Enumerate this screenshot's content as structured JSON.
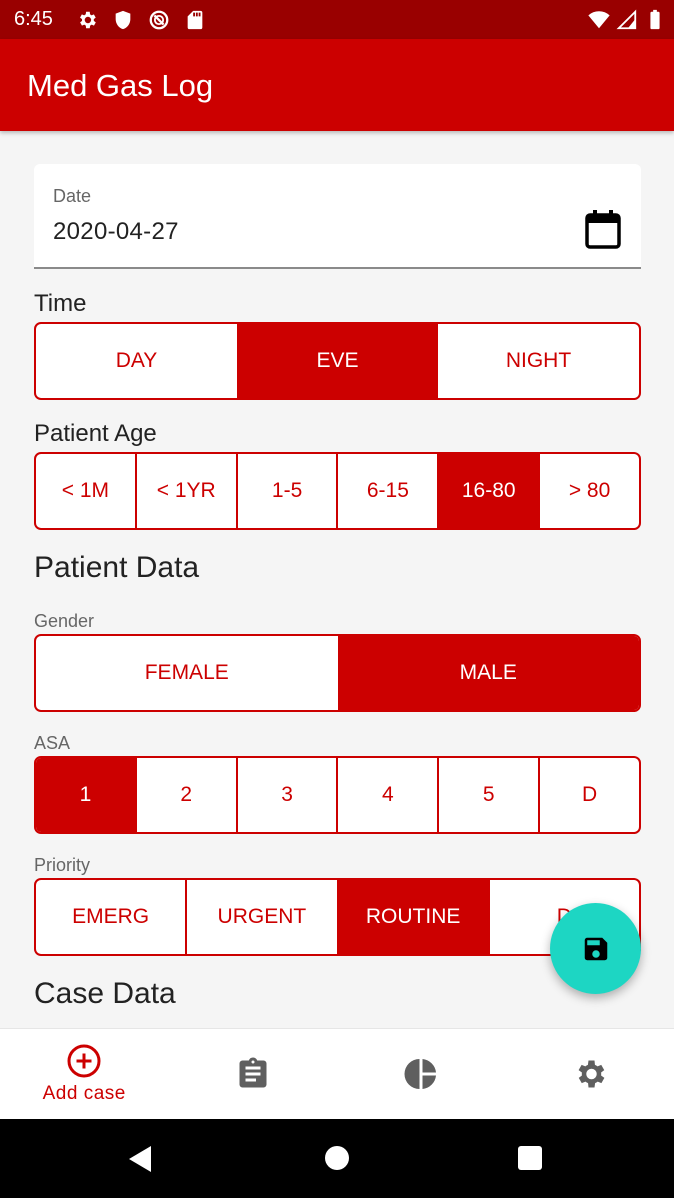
{
  "status_bar": {
    "time": "6:45",
    "left_icons": [
      "settings-icon",
      "shield-icon",
      "no-disturb-icon",
      "sd-card-icon"
    ],
    "right_icons": [
      "wifi-icon",
      "cell-signal-icon",
      "battery-icon"
    ]
  },
  "app_bar": {
    "title": "Med Gas Log"
  },
  "date_field": {
    "label": "Date",
    "value": "2020-04-27",
    "icon": "calendar-icon"
  },
  "time_group": {
    "label": "Time",
    "options": [
      "DAY",
      "EVE",
      "NIGHT"
    ],
    "selected": "EVE"
  },
  "age_group": {
    "label": "Patient Age",
    "options": [
      "< 1M",
      "< 1YR",
      "1-5",
      "6-15",
      "16-80",
      "> 80"
    ],
    "selected": "16-80"
  },
  "patient_data": {
    "heading": "Patient Data",
    "gender": {
      "label": "Gender",
      "options": [
        "FEMALE",
        "MALE"
      ],
      "selected": "MALE"
    },
    "asa": {
      "label": "ASA",
      "options": [
        "1",
        "2",
        "3",
        "4",
        "5",
        "D"
      ],
      "selected": "1"
    },
    "priority": {
      "label": "Priority",
      "options": [
        "EMERG",
        "URGENT",
        "ROUTINE",
        "D"
      ],
      "selected": "ROUTINE"
    }
  },
  "case_data": {
    "heading": "Case Data"
  },
  "fab": {
    "icon": "save-icon"
  },
  "bottom_nav": {
    "items": [
      {
        "label": "Add case",
        "icon": "add-circle-icon",
        "active": true
      },
      {
        "label": "",
        "icon": "clipboard-icon",
        "active": false
      },
      {
        "label": "",
        "icon": "pie-chart-icon",
        "active": false
      },
      {
        "label": "",
        "icon": "settings-icon",
        "active": false
      }
    ]
  },
  "colors": {
    "primary": "#cc0000",
    "primary_dark": "#990000",
    "accent": "#1dd6c3",
    "inactive_icon": "#5f5f5f"
  }
}
